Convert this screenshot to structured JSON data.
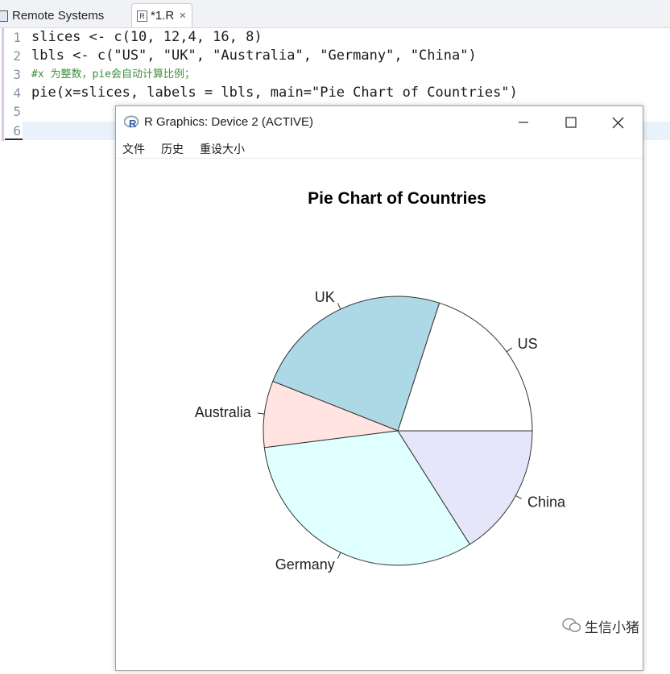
{
  "editor": {
    "tabs": [
      {
        "label": "Remote Systems",
        "active": false
      },
      {
        "label": "*1.R",
        "icon": "R",
        "active": true
      }
    ],
    "line_numbers": [
      "1",
      "2",
      "3",
      "4",
      "5",
      "6"
    ],
    "lines": [
      "slices <- c(10, 12,4, 16, 8)",
      "lbls <- c(\"US\", \"UK\", \"Australia\", \"Germany\", \"China\")",
      "#x 为整数，pie会自动计算比例；",
      "pie(x=slices, labels = lbls, main=\"Pie Chart of Countries\")",
      "",
      ""
    ]
  },
  "graphics_window": {
    "title": "R Graphics: Device 2 (ACTIVE)",
    "menu": [
      "文件",
      "历史",
      "重设大小"
    ]
  },
  "chart_data": {
    "type": "pie",
    "title": "Pie Chart of Countries",
    "labels": [
      "US",
      "UK",
      "Australia",
      "Germany",
      "China"
    ],
    "values": [
      10,
      12,
      4,
      16,
      8
    ],
    "colors": [
      "#ffffff",
      "#add8e6",
      "#ffe4e1",
      "#e0ffff",
      "#e6e6fa"
    ],
    "start_angle_deg": 0,
    "direction": "counterclockwise"
  },
  "watermark": {
    "text": "生信小猪",
    "icon": "wechat-icon"
  }
}
